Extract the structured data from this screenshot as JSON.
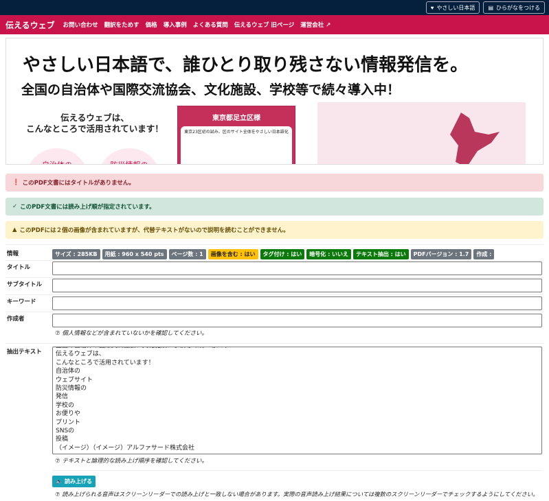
{
  "topbar": {
    "easy_japanese": "やさしい日本語",
    "furigana": "ひらがなをつける"
  },
  "nav": {
    "brand": "伝えるウェブ",
    "items": [
      "お問い合わせ",
      "翻訳をためす",
      "価格",
      "導入事例",
      "よくある質問",
      "伝えるウェブ 旧ページ",
      "運営会社"
    ]
  },
  "preview": {
    "headline": "やさしい日本語で、誰ひとり取り残さない情報発信を。",
    "subheadline": "全国の自治体や国際交流協会、文化施設、学校等で続々導入中！",
    "left_line1": "伝えるウェブは、",
    "left_line2": "こんなところで活用されています！",
    "circle1": "自治体の",
    "circle2": "防災情報の",
    "card_title": "東京都足立区様",
    "card_sub": "東京23区初の試み、区のサイト全体をやさしい日本語化"
  },
  "alerts": {
    "error": "このPDF文書にはタイトルがありません。",
    "success": "このPDF文書には読み上げ順が指定されています。",
    "warning": "このPDFには２個の画像が含まれていますが、代替テキストがないので説明を読むことができません。"
  },
  "info": {
    "label": "情報",
    "badges": [
      {
        "text": "サイズ : 285KB",
        "color": "gray"
      },
      {
        "text": "用紙 : 960 x 540 pts",
        "color": "gray"
      },
      {
        "text": "ページ数 : 1",
        "color": "gray"
      },
      {
        "text": "画像を含む : はい",
        "color": "yellow"
      },
      {
        "text": "タグ付け : はい",
        "color": "green"
      },
      {
        "text": "暗号化 : いいえ",
        "color": "green"
      },
      {
        "text": "テキスト抽出 : はい",
        "color": "green"
      },
      {
        "text": "PDFバージョン : 1.7",
        "color": "gray"
      },
      {
        "text": "作成 :",
        "color": "gray"
      }
    ]
  },
  "form": {
    "title_label": "タイトル",
    "title_value": "",
    "subtitle_label": "サブタイトル",
    "subtitle_value": "",
    "keywords_label": "キーワード",
    "keywords_value": "",
    "author_label": "作成者",
    "author_value": "",
    "privacy_hint": "⑦ 個人情報などが含まれていないかを確認してください。",
    "extract_label": "抽出テキスト",
    "extract_lines": [
      "全国の自治体や国際交流協会、文化施設、学校等で続々導入中！",
      "伝えるウェブは、",
      "こんなところで活用されています！",
      "自治体の",
      "ウェブサイト",
      "防災情報の",
      "発信",
      "学校の",
      "お便りや",
      "プリント",
      "SNSの",
      "投稿",
      "（イメージ）（イメージ）アルファサード株式会社"
    ],
    "extract_hint": "⑦ テキストと論理的な読み上げ順序を確認してください。",
    "speak_button": "読み上げる",
    "speak_note": "⑦ 読み上げられる音声はスクリーンリーダーでの読み上げと一致しない場合があります。実際の音声読み上げ結果については複数のスクリーンリーダーでチェックするようにしてください。"
  },
  "colors": {
    "topbar": "#04203d",
    "nav": "#c8144a",
    "speak": "#17a2b8"
  }
}
